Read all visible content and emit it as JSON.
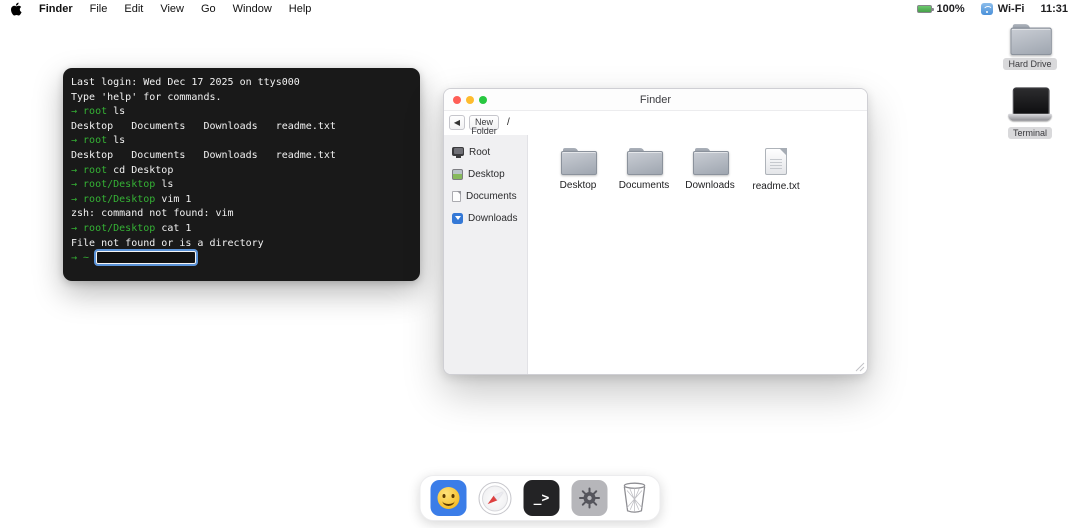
{
  "colors": {
    "terminal_green": "#35b235",
    "terminal_fg": "#f2f2f2",
    "terminal_bg": "#191919",
    "focus_ring": "#5b93d8",
    "traffic_red": "#ff5f57",
    "traffic_yellow": "#febc2e",
    "traffic_green": "#28c840",
    "dock_finder_blue": "#3b7de8",
    "battery_green": "#6cc96d",
    "wifi_blue": "#4a90d9",
    "folder_light": "#c9cdd4",
    "folder_dark": "#9fa6b0"
  },
  "menu_bar": {
    "items": [
      {
        "label": "Finder",
        "style": "bold"
      },
      {
        "label": "File"
      },
      {
        "label": "Edit"
      },
      {
        "label": "View"
      },
      {
        "label": "Go"
      },
      {
        "label": "Window"
      },
      {
        "label": "Help"
      }
    ],
    "status": {
      "battery": "100%",
      "network": "Wi-Fi",
      "time": "11:31"
    }
  },
  "terminal": {
    "lines": [
      {
        "spans": [
          {
            "t": "Last login: Wed Dec 17 2025 on ttys000",
            "c": "fg"
          }
        ]
      },
      {
        "spans": [
          {
            "t": "Type 'help' for commands.",
            "c": "fg"
          }
        ]
      },
      {
        "spans": [
          {
            "t": "→ root",
            "c": "green"
          },
          {
            "t": " ls",
            "c": "fg"
          }
        ]
      },
      {
        "spans": [
          {
            "t": "Desktop   Documents   Downloads   readme.txt",
            "c": "fg"
          }
        ]
      },
      {
        "spans": [
          {
            "t": "→ root",
            "c": "green"
          },
          {
            "t": " ls",
            "c": "fg"
          }
        ]
      },
      {
        "spans": [
          {
            "t": "Desktop   Documents   Downloads   readme.txt",
            "c": "fg"
          }
        ]
      },
      {
        "spans": [
          {
            "t": "→ root",
            "c": "green"
          },
          {
            "t": " cd Desktop",
            "c": "fg"
          }
        ]
      },
      {
        "spans": [
          {
            "t": "→ root/Desktop",
            "c": "green"
          },
          {
            "t": " ls",
            "c": "fg"
          }
        ]
      },
      {
        "spans": [
          {
            "t": "→ root/Desktop",
            "c": "green"
          },
          {
            "t": " vim 1",
            "c": "fg"
          }
        ]
      },
      {
        "spans": [
          {
            "t": "zsh: command not found: vim",
            "c": "fg"
          }
        ]
      },
      {
        "spans": [
          {
            "t": "→ root/Desktop",
            "c": "green"
          },
          {
            "t": " cat 1",
            "c": "fg"
          }
        ]
      },
      {
        "spans": [
          {
            "t": "File not found or is a directory",
            "c": "fg"
          }
        ]
      },
      {
        "spans": [
          {
            "t": "→ ~",
            "c": "green"
          }
        ],
        "input": true
      }
    ],
    "input_value": ""
  },
  "finder": {
    "title": "Finder",
    "toolbar": {
      "back": "◀",
      "new_folder": "New Folder",
      "path": "/"
    },
    "sidebar": [
      {
        "label": "Root",
        "icon": "computer"
      },
      {
        "label": "Desktop",
        "icon": "picture"
      },
      {
        "label": "Documents",
        "icon": "page"
      },
      {
        "label": "Downloads",
        "icon": "download"
      }
    ],
    "items": [
      {
        "label": "Desktop",
        "icon": "folder"
      },
      {
        "label": "Documents",
        "icon": "folder"
      },
      {
        "label": "Downloads",
        "icon": "folder"
      },
      {
        "label": "readme.txt",
        "icon": "file"
      }
    ]
  },
  "desktop_icons": [
    {
      "label": "Hard Drive",
      "icon": "folder"
    },
    {
      "label": "Terminal",
      "icon": "laptop"
    }
  ],
  "dock": {
    "terminal_glyph": "_>",
    "items": [
      "finder",
      "browser",
      "terminal",
      "settings",
      "trash"
    ]
  }
}
